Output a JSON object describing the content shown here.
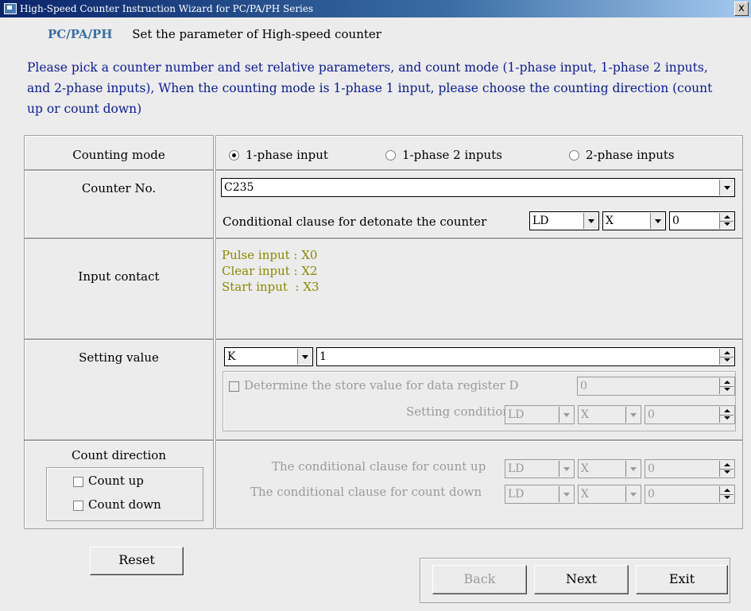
{
  "window": {
    "title": "High-Speed Counter Instruction Wizard for PC/PA/PH Series",
    "close_label": "x"
  },
  "header": {
    "brand": "PC/PA/PH",
    "subtitle": "Set the parameter of High-speed counter",
    "description": "Please pick a counter number and set relative parameters, and count mode (1-phase input, 1-phase 2 inputs, and 2-phase inputs), When the counting mode is 1-phase 1 input,  please choose the counting direction (count up or count down)"
  },
  "counting_mode": {
    "label": "Counting mode",
    "options": [
      "1-phase input",
      "1-phase 2 inputs",
      "2-phase inputs"
    ],
    "selected": "1-phase input"
  },
  "counter_no": {
    "label": "Counter No.",
    "value": "C235",
    "clause_label": "Conditional clause for detonate the counter",
    "clause_instr": "LD",
    "clause_device": "X",
    "clause_number": "0"
  },
  "input_contact": {
    "label": "Input contact",
    "lines": [
      "Pulse input : X0",
      "Clear input : X2",
      "Start input  : X3"
    ]
  },
  "setting_value": {
    "label": "Setting value",
    "type": "K",
    "value": "1",
    "store_label": "Determine the store value for data register D",
    "store_value": "0",
    "setting_cond_label": "Setting conditional",
    "cond_instr": "LD",
    "cond_device": "X",
    "cond_number": "0"
  },
  "count_direction": {
    "label": "Count direction",
    "count_up": "Count up",
    "count_down": "Count down",
    "up_clause_label": "The conditional clause for count up",
    "up_instr": "LD",
    "up_device": "X",
    "up_number": "0",
    "down_clause_label": "The conditional clause for count down",
    "down_instr": "LD",
    "down_device": "X",
    "down_number": "0"
  },
  "buttons": {
    "reset": "Reset",
    "back": "Back",
    "next": "Next",
    "exit": "Exit"
  }
}
